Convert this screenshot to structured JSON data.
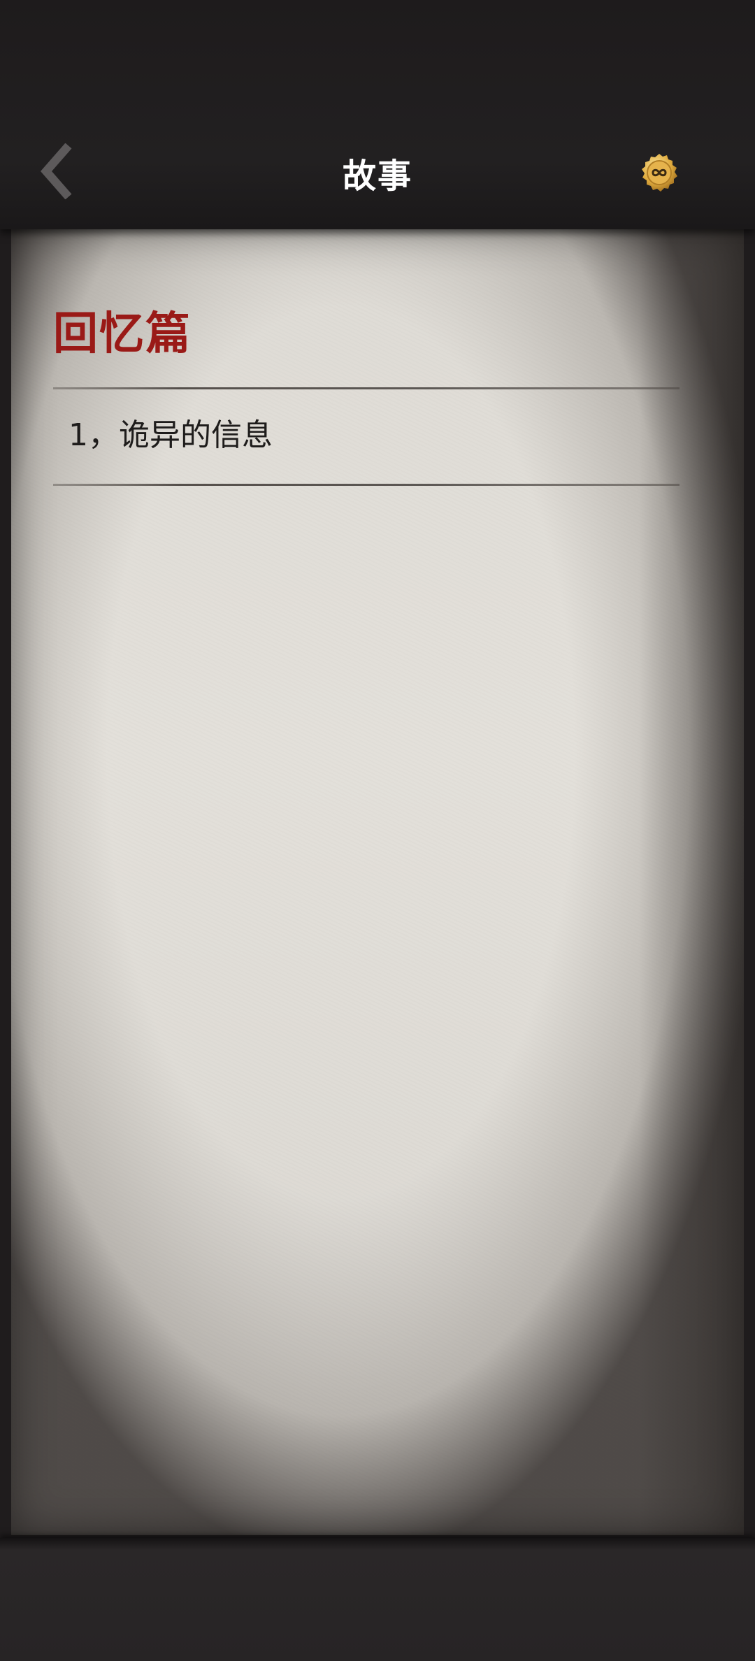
{
  "header": {
    "title": "故事",
    "back_icon": "chevron-left-icon",
    "coin_icon": "gold-coin-infinity-icon"
  },
  "content": {
    "section_title": "回忆篇",
    "items": [
      {
        "label": "1，诡异的信息"
      }
    ]
  },
  "colors": {
    "section_title": "#9a1a17",
    "header_bg": "#1e1b1c",
    "paper": "#dedbd5",
    "coin": "#d9a43a"
  }
}
